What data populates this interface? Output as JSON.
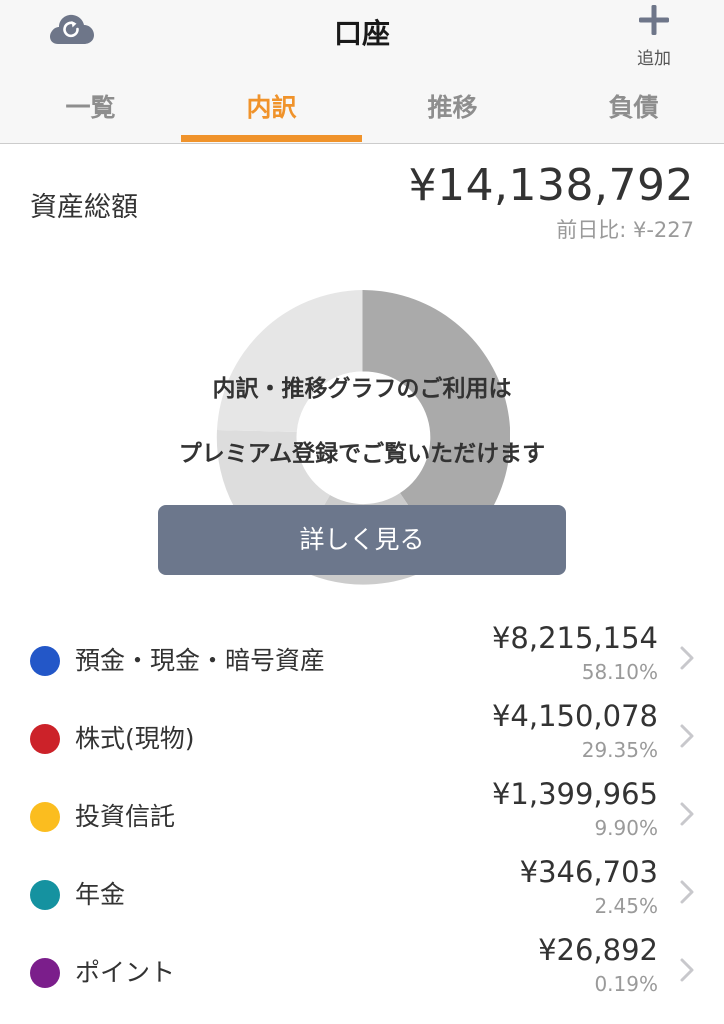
{
  "header": {
    "title": "口座",
    "sync_icon": "cloud-sync-icon",
    "add_icon": "plus-icon",
    "add_label": "追加"
  },
  "tabs": [
    {
      "label": "一覧",
      "active": false
    },
    {
      "label": "内訳",
      "active": true
    },
    {
      "label": "推移",
      "active": false
    },
    {
      "label": "負債",
      "active": false
    }
  ],
  "colors": {
    "accent": "#f0932b",
    "button": "#6c778c"
  },
  "total": {
    "label": "資産総額",
    "value": "¥14,138,792",
    "diff": "前日比: ¥-227"
  },
  "premium": {
    "line1": "内訳・推移グラフのご利用は",
    "line2": "プレミアム登録でご覧いただけます",
    "button_label": "詳しく見る"
  },
  "assets": [
    {
      "name": "預金・現金・暗号資産",
      "amount": "¥8,215,154",
      "pct": "58.10%",
      "color": "#2357c8"
    },
    {
      "name": "株式(現物)",
      "amount": "¥4,150,078",
      "pct": "29.35%",
      "color": "#cc2229"
    },
    {
      "name": "投資信託",
      "amount": "¥1,399,965",
      "pct": "9.90%",
      "color": "#fbbd1f"
    },
    {
      "name": "年金",
      "amount": "¥346,703",
      "pct": "2.45%",
      "color": "#1592a0"
    },
    {
      "name": "ポイント",
      "amount": "¥26,892",
      "pct": "0.19%",
      "color": "#7b1e8b"
    }
  ]
}
